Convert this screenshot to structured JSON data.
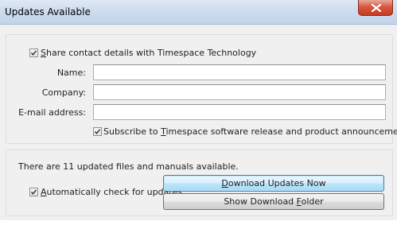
{
  "window": {
    "title": "Updates Available",
    "close_label": "close"
  },
  "contact": {
    "share_checkbox": {
      "checked": true,
      "prefix": "",
      "mnemonic": "S",
      "rest": "hare contact details with Timespace Technology"
    },
    "name_label": "Name:",
    "name_value": "",
    "company_label": "Company:",
    "company_value": "",
    "email_label": "E-mail address:",
    "email_value": "",
    "subscribe_checkbox": {
      "checked": true,
      "prefix": "Subscribe to ",
      "mnemonic": "T",
      "rest": "imespace software release and product announcements"
    }
  },
  "updates": {
    "status_text": "There are 11 updated files and manuals available.",
    "auto_check": {
      "checked": true,
      "prefix": "",
      "mnemonic": "A",
      "rest": "utomatically check for updates"
    },
    "download_button": {
      "prefix": "",
      "mnemonic": "D",
      "rest": "ownload Updates Now"
    },
    "folder_button": {
      "prefix": "Show Download ",
      "mnemonic": "F",
      "rest": "older"
    }
  }
}
